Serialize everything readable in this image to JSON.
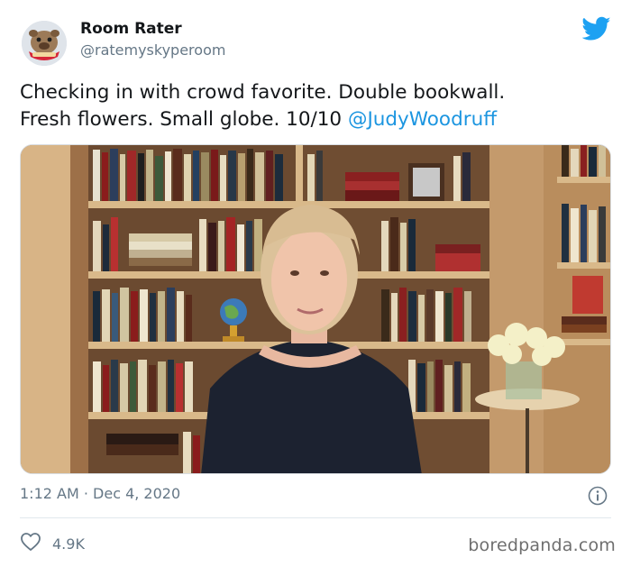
{
  "tweet": {
    "author_name": "Room Rater",
    "handle": "@ratemyskyperoom",
    "avatar_icon": "bulldog-mascot-avatar",
    "text_line1": "Checking in with crowd favorite. Double bookwall.",
    "text_line2_prefix": "Fresh flowers. Small globe.  10/10 ",
    "mention": "@JudyWoodruff",
    "timestamp": "1:12 AM · Dec 4, 2020",
    "likes": "4.9K"
  },
  "icons": {
    "brand": "twitter-bird-icon",
    "info": "info-icon",
    "like": "heart-icon"
  },
  "watermark": "boredpanda.com",
  "colors": {
    "link": "#1b95e0",
    "brand": "#1da1f2",
    "secondary_text": "#657786"
  }
}
